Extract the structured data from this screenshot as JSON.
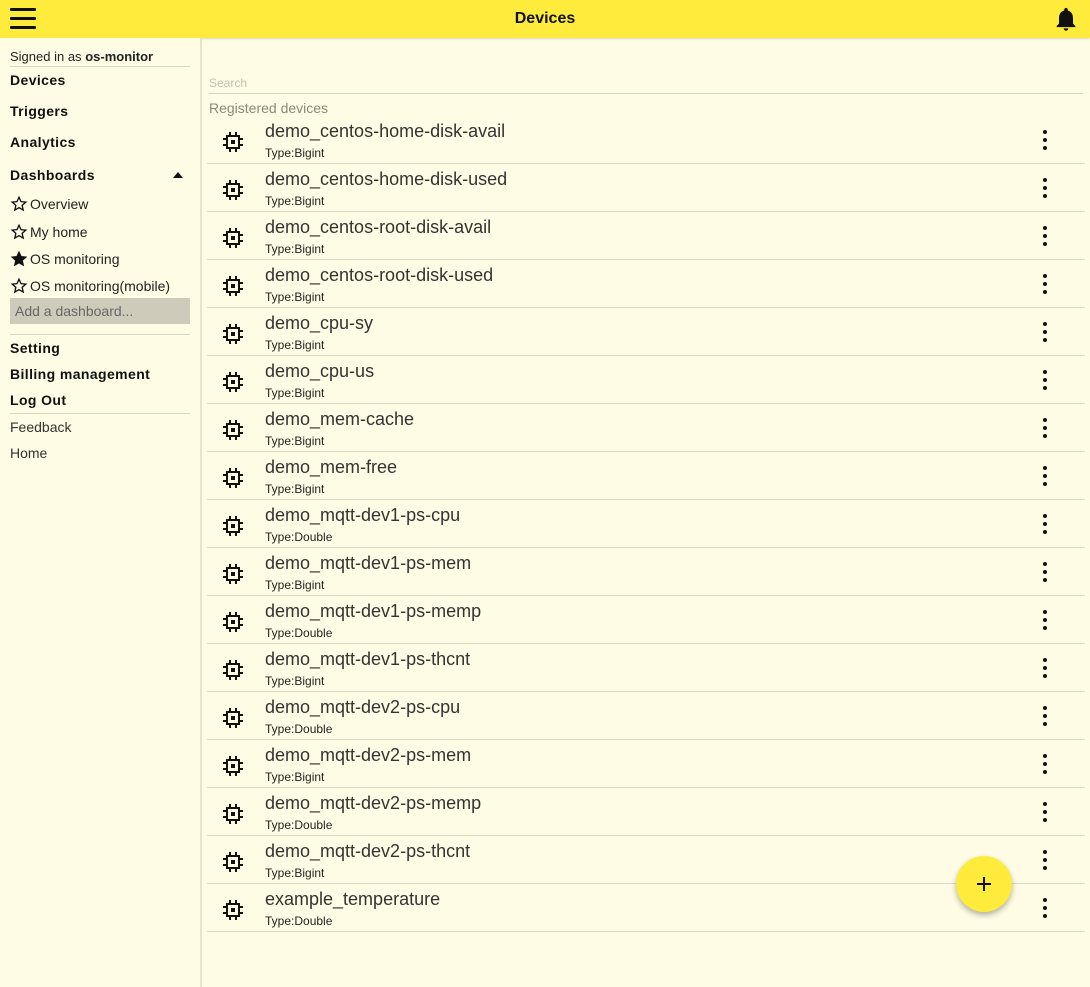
{
  "header": {
    "title": "Devices",
    "menu_icon": "hamburger-menu-icon",
    "bell_icon": "bell-icon"
  },
  "accent_color": "#ffeb3b",
  "sidebar": {
    "signed_prefix": "Signed in as",
    "username": "os-monitor",
    "nav": {
      "devices": "Devices",
      "triggers": "Triggers",
      "analytics": "Analytics",
      "dashboards": "Dashboards"
    },
    "dashboards": [
      {
        "label": "Overview",
        "starred": false
      },
      {
        "label": "My home",
        "starred": false
      },
      {
        "label": "OS monitoring",
        "starred": true
      },
      {
        "label": "OS monitoring(mobile)",
        "starred": false
      }
    ],
    "add_dashboard_placeholder": "Add a dashboard...",
    "setting": "Setting",
    "billing": "Billing management",
    "logout": "Log Out",
    "feedback": "Feedback",
    "home": "Home"
  },
  "main": {
    "search_placeholder": "Search",
    "section_label": "Registered devices",
    "devices": [
      {
        "name": "demo_centos-home-disk-avail",
        "type": "Type:Bigint"
      },
      {
        "name": "demo_centos-home-disk-used",
        "type": "Type:Bigint"
      },
      {
        "name": "demo_centos-root-disk-avail",
        "type": "Type:Bigint"
      },
      {
        "name": "demo_centos-root-disk-used",
        "type": "Type:Bigint"
      },
      {
        "name": "demo_cpu-sy",
        "type": "Type:Bigint"
      },
      {
        "name": "demo_cpu-us",
        "type": "Type:Bigint"
      },
      {
        "name": "demo_mem-cache",
        "type": "Type:Bigint"
      },
      {
        "name": "demo_mem-free",
        "type": "Type:Bigint"
      },
      {
        "name": "demo_mqtt-dev1-ps-cpu",
        "type": "Type:Double"
      },
      {
        "name": "demo_mqtt-dev1-ps-mem",
        "type": "Type:Bigint"
      },
      {
        "name": "demo_mqtt-dev1-ps-memp",
        "type": "Type:Double"
      },
      {
        "name": "demo_mqtt-dev1-ps-thcnt",
        "type": "Type:Bigint"
      },
      {
        "name": "demo_mqtt-dev2-ps-cpu",
        "type": "Type:Double"
      },
      {
        "name": "demo_mqtt-dev2-ps-mem",
        "type": "Type:Bigint"
      },
      {
        "name": "demo_mqtt-dev2-ps-memp",
        "type": "Type:Double"
      },
      {
        "name": "demo_mqtt-dev2-ps-thcnt",
        "type": "Type:Bigint"
      },
      {
        "name": "example_temperature",
        "type": "Type:Double"
      }
    ]
  },
  "fab": {
    "icon": "plus-icon"
  }
}
